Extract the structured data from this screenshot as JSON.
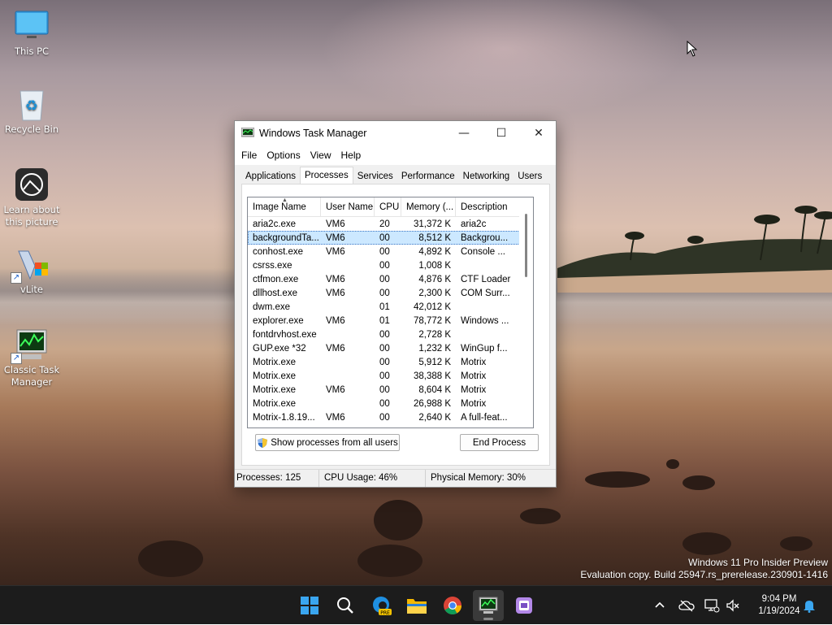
{
  "desktop": {
    "icons": [
      {
        "label": "This PC"
      },
      {
        "label": "Recycle Bin"
      },
      {
        "label": "Learn about this picture"
      },
      {
        "label": "vLite"
      },
      {
        "label": "Classic Task Manager"
      }
    ]
  },
  "window": {
    "title": "Windows Task Manager",
    "controls": {
      "minimize": "—",
      "maximize": "☐",
      "close": "✕"
    },
    "menu": [
      "File",
      "Options",
      "View",
      "Help"
    ],
    "tabs": [
      "Applications",
      "Processes",
      "Services",
      "Performance",
      "Networking",
      "Users"
    ],
    "active_tab": "Processes",
    "columns": [
      "Image Name",
      "User Name",
      "CPU",
      "Memory (...",
      "Description"
    ],
    "processes": [
      {
        "name": "aria2c.exe",
        "user": "VM6",
        "cpu": "20",
        "mem": "31,372 K",
        "desc": "aria2c"
      },
      {
        "name": "backgroundTa...",
        "user": "VM6",
        "cpu": "00",
        "mem": "8,512 K",
        "desc": "Backgrou..."
      },
      {
        "name": "conhost.exe",
        "user": "VM6",
        "cpu": "00",
        "mem": "4,892 K",
        "desc": "Console ..."
      },
      {
        "name": "csrss.exe",
        "user": "",
        "cpu": "00",
        "mem": "1,008 K",
        "desc": ""
      },
      {
        "name": "ctfmon.exe",
        "user": "VM6",
        "cpu": "00",
        "mem": "4,876 K",
        "desc": "CTF Loader"
      },
      {
        "name": "dllhost.exe",
        "user": "VM6",
        "cpu": "00",
        "mem": "2,300 K",
        "desc": "COM Surr..."
      },
      {
        "name": "dwm.exe",
        "user": "",
        "cpu": "01",
        "mem": "42,012 K",
        "desc": ""
      },
      {
        "name": "explorer.exe",
        "user": "VM6",
        "cpu": "01",
        "mem": "78,772 K",
        "desc": "Windows ..."
      },
      {
        "name": "fontdrvhost.exe",
        "user": "",
        "cpu": "00",
        "mem": "2,728 K",
        "desc": ""
      },
      {
        "name": "GUP.exe *32",
        "user": "VM6",
        "cpu": "00",
        "mem": "1,232 K",
        "desc": "WinGup f..."
      },
      {
        "name": "Motrix.exe",
        "user": "",
        "cpu": "00",
        "mem": "5,912 K",
        "desc": "Motrix"
      },
      {
        "name": "Motrix.exe",
        "user": "",
        "cpu": "00",
        "mem": "38,388 K",
        "desc": "Motrix"
      },
      {
        "name": "Motrix.exe",
        "user": "VM6",
        "cpu": "00",
        "mem": "8,604 K",
        "desc": "Motrix"
      },
      {
        "name": "Motrix.exe",
        "user": "",
        "cpu": "00",
        "mem": "26,988 K",
        "desc": "Motrix"
      },
      {
        "name": "Motrix-1.8.19...",
        "user": "VM6",
        "cpu": "00",
        "mem": "2,640 K",
        "desc": "A full-feat..."
      }
    ],
    "selected_index": 1,
    "buttons": {
      "show_all": "Show processes from all users",
      "end_process": "End Process"
    },
    "status": {
      "processes": "Processes: 125",
      "cpu": "CPU Usage: 46%",
      "memory": "Physical Memory: 30%"
    }
  },
  "watermark": {
    "line1": "Windows 11 Pro Insider Preview",
    "line2": "Evaluation copy. Build 25947.rs_prerelease.230901-1416"
  },
  "taskbar": {
    "apps": [
      "start-icon",
      "search-icon",
      "edge-beta-icon",
      "file-explorer-icon",
      "chrome-icon",
      "task-manager-icon",
      "app-icon"
    ],
    "clock": {
      "time": "9:04 PM",
      "date": "1/19/2024"
    }
  }
}
